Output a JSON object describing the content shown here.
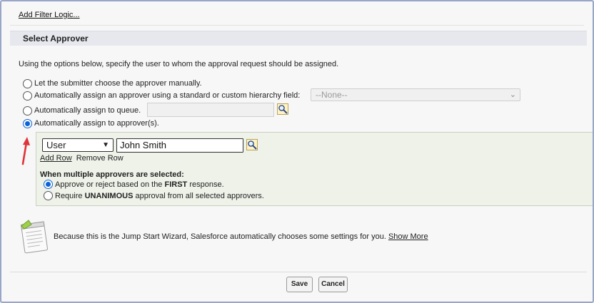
{
  "filter_logic_link": "Add Filter Logic...",
  "section": {
    "title": "Select Approver"
  },
  "intro_text": "Using the options below, specify the user to whom the approval request should be assigned.",
  "options": {
    "manual": "Let the submitter choose the approver manually.",
    "hierarchy": "Automatically assign an approver using a standard or custom hierarchy field:",
    "queue": "Automatically assign to queue.",
    "approvers": "Automatically assign to approver(s)."
  },
  "hierarchy_select": {
    "value": "--None--"
  },
  "approver_row": {
    "type_select": {
      "value": "User"
    },
    "name_value": "John Smith"
  },
  "row_links": {
    "add": "Add Row",
    "remove": "Remove Row"
  },
  "multiple": {
    "title": "When multiple approvers are selected:",
    "first_prefix": "Approve or reject based on the ",
    "first_bold": "FIRST",
    "first_suffix": " response.",
    "unan_prefix": "Require ",
    "unan_bold": "UNANIMOUS",
    "unan_suffix": " approval from all selected approvers."
  },
  "note": {
    "text": "Because this is the Jump Start Wizard, Salesforce automatically chooses some settings for you.",
    "link": "Show More"
  },
  "buttons": {
    "save": "Save",
    "cancel": "Cancel"
  },
  "colors": {
    "accent": "#0b62d6",
    "arrow": "#e0333a",
    "panel": "#eef2e9"
  },
  "icons": [
    "lookup-icon",
    "red-arrow-icon",
    "notepad-icon",
    "chevron-down-icon"
  ],
  "state": {
    "selected_option": "approvers",
    "multiple_mode": "first"
  }
}
